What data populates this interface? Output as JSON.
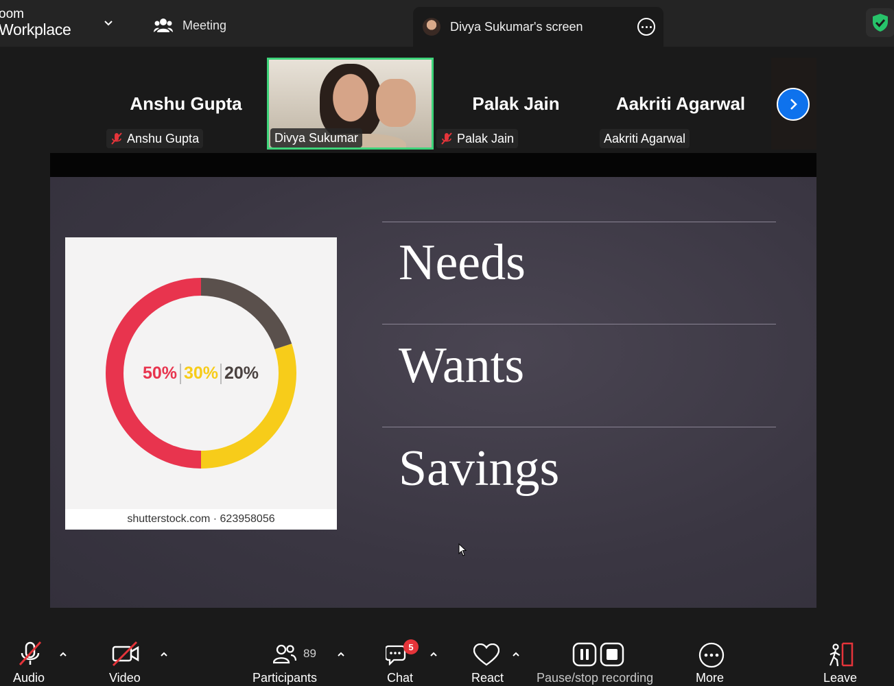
{
  "app": {
    "brand_line1": "oom",
    "brand_line2": "Workplace"
  },
  "tabs": {
    "meeting": "Meeting",
    "share": "Divya Sukumar's screen"
  },
  "participants": [
    {
      "name": "Anshu Gupta",
      "tag": "Anshu Gupta",
      "muted": true
    },
    {
      "name": "Divya Sukumar",
      "tag": "Divya Sukumar",
      "muted": false,
      "video": true
    },
    {
      "name": "Palak Jain",
      "tag": "Palak Jain",
      "muted": true
    },
    {
      "name": "Aakriti Agarwal",
      "tag": "Aakriti Agarwal",
      "muted": false
    }
  ],
  "slide": {
    "items": [
      "Needs",
      "Wants",
      "Savings"
    ],
    "image_caption": "shutterstock.com · 623958056",
    "donut_labels": [
      "50%",
      "30%",
      "20%"
    ],
    "donut_values": [
      50,
      30,
      20
    ],
    "donut_colors": [
      "#e8344e",
      "#f7cc1a",
      "#5a504c"
    ]
  },
  "toolbar": {
    "audio": "Audio",
    "video": "Video",
    "participants": "Participants",
    "participants_count": "89",
    "chat": "Chat",
    "chat_badge": "5",
    "react": "React",
    "recording": "Pause/stop recording",
    "more": "More",
    "leave": "Leave"
  },
  "colors": {
    "active_border": "#3ed47a",
    "accent": "#0e72ed",
    "danger": "#e5343a",
    "shield": "#27c36a"
  }
}
